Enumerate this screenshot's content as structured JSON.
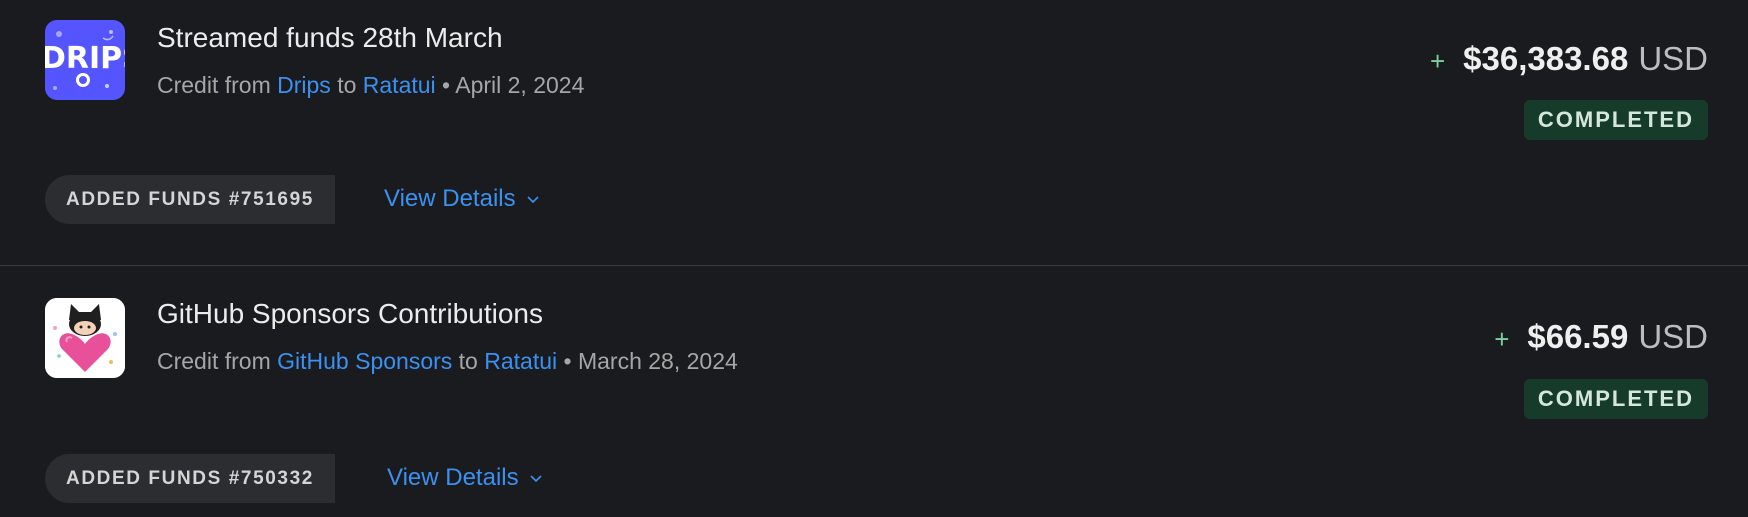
{
  "transactions": [
    {
      "logo_icon": "drips-logo",
      "logo_text": "DRIPS",
      "title": "Streamed funds 28th March",
      "credit_prefix": "Credit from",
      "source": "Drips",
      "to_word": "to",
      "recipient": "Ratatui",
      "separator": "•",
      "date": "April 2, 2024",
      "plus": "+",
      "amount": "$36,383.68",
      "currency": "USD",
      "status": "COMPLETED",
      "badge": "ADDED FUNDS #751695",
      "view_details": "View Details"
    },
    {
      "logo_icon": "github-sponsors-logo",
      "title": "GitHub Sponsors Contributions",
      "credit_prefix": "Credit from",
      "source": "GitHub Sponsors",
      "to_word": "to",
      "recipient": "Ratatui",
      "separator": "•",
      "date": "March 28, 2024",
      "plus": "+",
      "amount": "$66.59",
      "currency": "USD",
      "status": "COMPLETED",
      "badge": "ADDED FUNDS #750332",
      "view_details": "View Details"
    }
  ],
  "colors": {
    "background": "#1a1b1e",
    "link": "#3c91f0",
    "status_bg": "#173b2a",
    "plus": "#7fcf9e",
    "drips_brand": "#5555ff"
  }
}
